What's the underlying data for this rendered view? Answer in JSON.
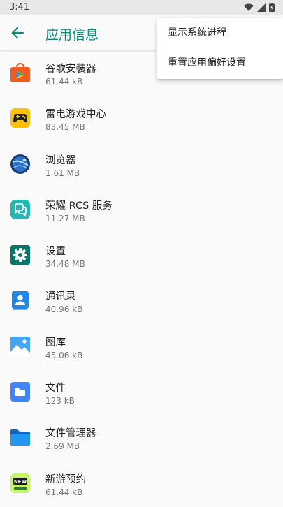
{
  "status_bar": {
    "time": "3:41"
  },
  "app_bar": {
    "title": "应用信息"
  },
  "menu": {
    "items": [
      {
        "label": "显示系统进程"
      },
      {
        "label": "重置应用偏好设置"
      }
    ]
  },
  "apps": [
    {
      "name": "谷歌安装器",
      "size": "61.44 kB",
      "icon": "google-installer-icon"
    },
    {
      "name": "雷电游戏中心",
      "size": "83.45 MB",
      "icon": "game-center-icon"
    },
    {
      "name": "浏览器",
      "size": "1.61 MB",
      "icon": "browser-icon"
    },
    {
      "name": "荣耀 RCS 服务",
      "size": "11.27 MB",
      "icon": "rcs-service-icon"
    },
    {
      "name": "设置",
      "size": "34.48 MB",
      "icon": "settings-icon"
    },
    {
      "name": "通讯录",
      "size": "40.96 kB",
      "icon": "contacts-icon"
    },
    {
      "name": "图库",
      "size": "45.06 kB",
      "icon": "gallery-icon"
    },
    {
      "name": "文件",
      "size": "123 kB",
      "icon": "files-icon"
    },
    {
      "name": "文件管理器",
      "size": "2.69 MB",
      "icon": "file-manager-icon"
    },
    {
      "name": "新游预约",
      "size": "61.44 kB",
      "icon": "new-game-booking-icon",
      "badge": "NEW"
    }
  ],
  "colors": {
    "accent": "#0d8a7e",
    "status_bar_bg": "#e8e8e8"
  }
}
